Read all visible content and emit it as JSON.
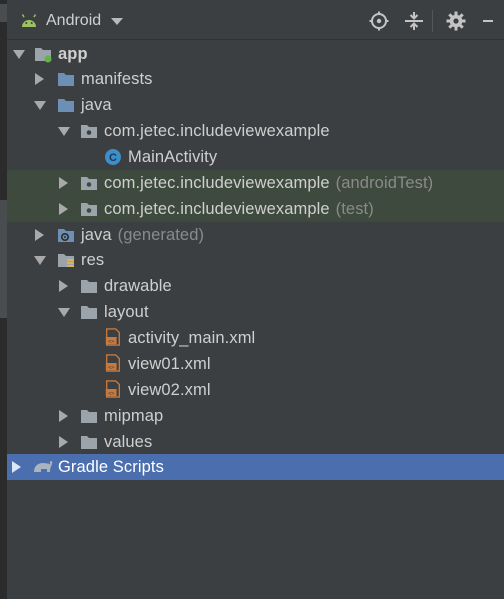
{
  "header": {
    "view_mode": "Android",
    "android_color": "#9cc25e"
  },
  "tree": {
    "app": "app",
    "manifests": "manifests",
    "java": "java",
    "pkg_main": "com.jetec.includeviewexample",
    "main_activity": "MainActivity",
    "pkg_android_test": "com.jetec.includeviewexample",
    "android_test_suffix": "(androidTest)",
    "pkg_test": "com.jetec.includeviewexample",
    "test_suffix": "(test)",
    "java_generated": "java",
    "generated_suffix": "(generated)",
    "res": "res",
    "drawable": "drawable",
    "layout": "layout",
    "activity_main": "activity_main.xml",
    "view01": "view01.xml",
    "view02": "view02.xml",
    "mipmap": "mipmap",
    "values": "values",
    "gradle_scripts": "Gradle Scripts"
  },
  "colors": {
    "selected_row": "#4b6eaf",
    "test_rows": "#3f4a3e",
    "class_icon": "#3d8ec9",
    "xml_icon": "#c8793b"
  }
}
